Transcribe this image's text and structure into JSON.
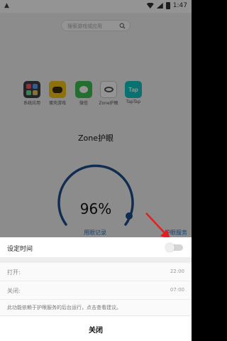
{
  "status_bar": {
    "time": "1:47"
  },
  "search": {
    "placeholder": "搜索游戏或应用"
  },
  "apps": [
    {
      "label": "系统应用",
      "icon": "apps-grid-icon"
    },
    {
      "label": "蛋壳游戏",
      "icon": "gamepad-icon"
    },
    {
      "label": "微信",
      "icon": "wechat-icon"
    },
    {
      "label": "Zone护眼",
      "icon": "eye-icon"
    },
    {
      "label": "TapTap",
      "icon": "taptap-icon",
      "tile_text": "Tap"
    }
  ],
  "main": {
    "title": "Zone护眼",
    "percent": "96%",
    "record_link": "用眼记录",
    "protect_link": "护眼服务"
  },
  "sheet": {
    "title": "设定时间",
    "toggle_on": false,
    "on_label": "打开:",
    "on_value": "22:00",
    "off_label": "关闭:",
    "off_value": "07:00",
    "hint": "此功能依赖于护眼服务的后台运行，点击查看建议。",
    "close_label": "关闭"
  },
  "colors": {
    "accent": "#2a6fb8",
    "gauge_ring": "#1c4f8c",
    "arrow": "#e02020"
  }
}
